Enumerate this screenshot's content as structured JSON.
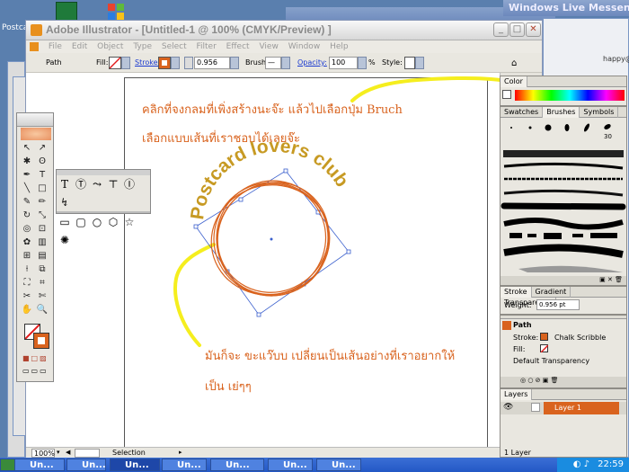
{
  "desktop": {
    "icon_label": "Postcard",
    "bg_window_title": "Windows Live Messenger",
    "bg_window_email": "happy@hotmail."
  },
  "window": {
    "title": "Adobe Illustrator - [Untitled-1 @ 100% (CMYK/Preview) ]",
    "menu": [
      "File",
      "Edit",
      "Object",
      "Type",
      "Select",
      "Filter",
      "Effect",
      "View",
      "Window",
      "Help"
    ]
  },
  "control_bar": {
    "object_label": "Path",
    "fill_label": "Fill:",
    "stroke_label": "Stroke:",
    "stroke_weight": "0.956",
    "brush_label": "Brush:",
    "opacity_label": "Opacity:",
    "opacity_value": "100",
    "opacity_unit": "%",
    "style_label": "Style:"
  },
  "canvas": {
    "note_top_line1": "คลิกที่จงกลมที่เพิ่งสร้างนะจ๊ะ  แล้วไปเลือกปุ่ม  Bruch",
    "note_top_line2": "เลือกแบบเส้นที่เราชอบได้เลยจ๊ะ",
    "curved_text": "Postcard lovers club",
    "note_bottom_line1": "มันก็จะ  ขะแว๊บบ  เปลี่ยนเป็นเส้นอย่างที่เราอยากให้",
    "note_bottom_line2": "เป็น  เย่ๆๆ"
  },
  "status_bar": {
    "zoom": "100%",
    "mode": "Selection"
  },
  "color_panel": {
    "tab": "Color"
  },
  "brushes_panel": {
    "tabs": [
      "Swatches",
      "Brushes",
      "Symbols"
    ],
    "brush_size": "30"
  },
  "stroke_panel": {
    "tabs": [
      "Stroke",
      "Gradient",
      "Transparency"
    ],
    "weight_label": "Weight:",
    "weight_value": "0.956 pt"
  },
  "appearance_panel": {
    "title": "Path",
    "stroke_label": "Stroke:",
    "stroke_value": "Chalk Scribble",
    "fill_label": "Fill:",
    "transparency": "Default Transparency"
  },
  "layers_panel": {
    "tab": "Layers",
    "layer_name": "Layer 1",
    "footer": "1 Layer"
  },
  "taskbar": {
    "tasks": [
      "Un...",
      "Un...",
      "Un...",
      "Un...",
      "Un...",
      "Un...",
      "Un..."
    ],
    "clock": "22:59"
  },
  "colors": {
    "accent": "#d9631e",
    "highlight": "#f5ee1e",
    "selection": "#3a5fcd"
  }
}
